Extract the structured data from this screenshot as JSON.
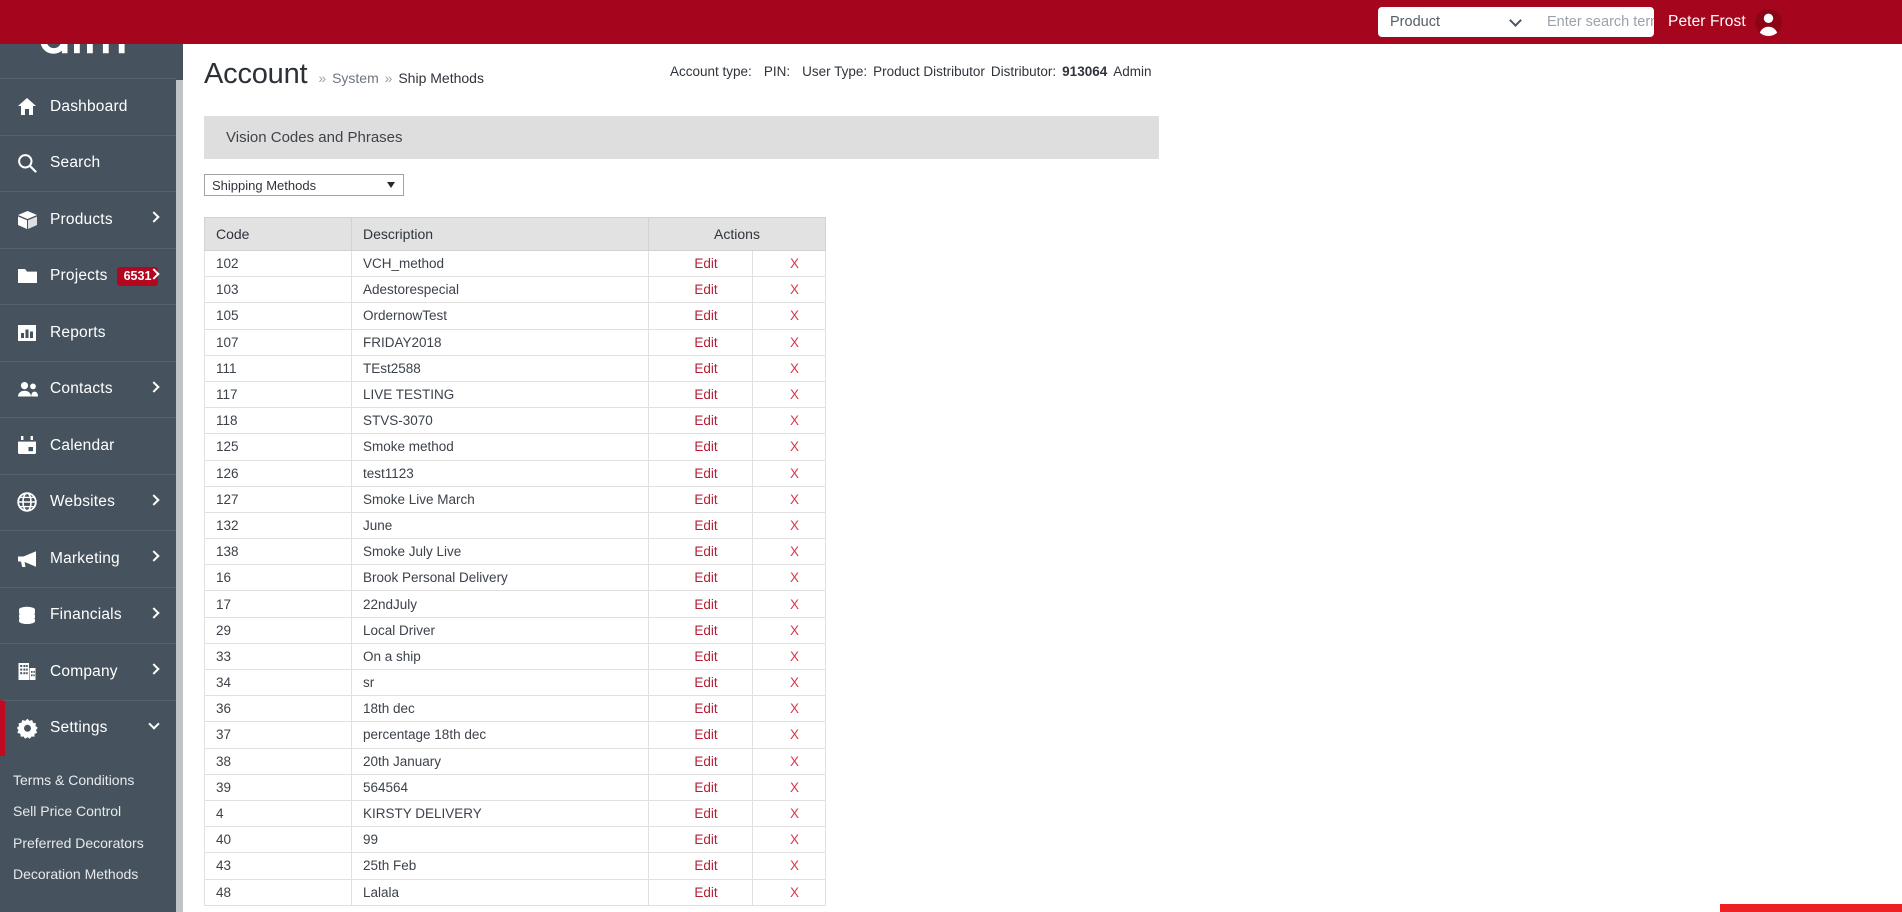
{
  "brand": {
    "logo_text": "aim",
    "logo_tm": "™",
    "accent_dark_red": "#A5051D",
    "accent_bright_red": "#ED2024",
    "sidebar_bg": "#46535E"
  },
  "topbar": {
    "search_category_selected": "Product",
    "search_category_options": [
      "Product"
    ],
    "search_placeholder": "Enter search term...",
    "search_value": "",
    "search_icon": "search-icon",
    "user_name": "Peter Frost",
    "avatar_icon": "user-avatar-icon"
  },
  "sidebar": {
    "collapse_icon": "chevron-left-icon",
    "items": [
      {
        "label": "Dashboard",
        "icon": "home-icon",
        "chevron": "none",
        "badge": ""
      },
      {
        "label": "Search",
        "icon": "search-icon",
        "chevron": "none",
        "badge": ""
      },
      {
        "label": "Products",
        "icon": "box-icon",
        "chevron": "right",
        "badge": ""
      },
      {
        "label": "Projects",
        "icon": "folder-icon",
        "chevron": "right",
        "badge": "6531"
      },
      {
        "label": "Reports",
        "icon": "bar-chart-icon",
        "chevron": "none",
        "badge": ""
      },
      {
        "label": "Contacts",
        "icon": "people-icon",
        "chevron": "right",
        "badge": ""
      },
      {
        "label": "Calendar",
        "icon": "calendar-icon",
        "chevron": "none",
        "badge": ""
      },
      {
        "label": "Websites",
        "icon": "globe-icon",
        "chevron": "right",
        "badge": ""
      },
      {
        "label": "Marketing",
        "icon": "megaphone-icon",
        "chevron": "right",
        "badge": ""
      },
      {
        "label": "Financials",
        "icon": "coins-icon",
        "chevron": "right",
        "badge": ""
      },
      {
        "label": "Company",
        "icon": "building-icon",
        "chevron": "right",
        "badge": ""
      },
      {
        "label": "Settings",
        "icon": "gear-icon",
        "chevron": "down",
        "badge": "",
        "active": true
      }
    ],
    "subitems": [
      {
        "label": "Terms & Conditions"
      },
      {
        "label": "Sell Price Control"
      },
      {
        "label": "Preferred Decorators"
      },
      {
        "label": "Decoration Methods"
      }
    ]
  },
  "page": {
    "title": "Account",
    "breadcrumb_sep": "»",
    "breadcrumb_1": "System",
    "breadcrumb_2": "Ship Methods",
    "meta": {
      "account_type_label": "Account type:",
      "account_type_value": "",
      "pin_label": "PIN:",
      "pin_value": "",
      "user_type_label": "User Type:",
      "user_type_value": "Product Distributor",
      "distributor_label": "Distributor:",
      "distributor_value": "913064",
      "admin_label": "Admin"
    }
  },
  "panel": {
    "heading": "Vision Codes and Phrases",
    "mode_selected": "Shipping Methods",
    "mode_options": [
      "Shipping Methods"
    ]
  },
  "table": {
    "columns": [
      "Code",
      "Description",
      "Actions"
    ],
    "edit_label": "Edit",
    "delete_label": "X",
    "rows": [
      {
        "code": "102",
        "description": "VCH_method"
      },
      {
        "code": "103",
        "description": "Adestorespecial"
      },
      {
        "code": "105",
        "description": "OrdernowTest"
      },
      {
        "code": "107",
        "description": "FRIDAY2018"
      },
      {
        "code": "111",
        "description": "TEst2588"
      },
      {
        "code": "117",
        "description": "LIVE TESTING"
      },
      {
        "code": "118",
        "description": "STVS-3070"
      },
      {
        "code": "125",
        "description": "Smoke method"
      },
      {
        "code": "126",
        "description": "test1123"
      },
      {
        "code": "127",
        "description": "Smoke Live March"
      },
      {
        "code": "132",
        "description": "June"
      },
      {
        "code": "138",
        "description": "Smoke July Live"
      },
      {
        "code": "16",
        "description": "Brook Personal Delivery"
      },
      {
        "code": "17",
        "description": "22ndJuly"
      },
      {
        "code": "29",
        "description": "Local Driver"
      },
      {
        "code": "33",
        "description": "On a ship"
      },
      {
        "code": "34",
        "description": "sr"
      },
      {
        "code": "36",
        "description": "18th dec"
      },
      {
        "code": "37",
        "description": "percentage 18th dec"
      },
      {
        "code": "38",
        "description": "20th January"
      },
      {
        "code": "39",
        "description": "564564"
      },
      {
        "code": "4",
        "description": "KIRSTY DELIVERY"
      },
      {
        "code": "40",
        "description": "99"
      },
      {
        "code": "43",
        "description": "25th Feb"
      },
      {
        "code": "48",
        "description": "Lalala"
      }
    ]
  }
}
